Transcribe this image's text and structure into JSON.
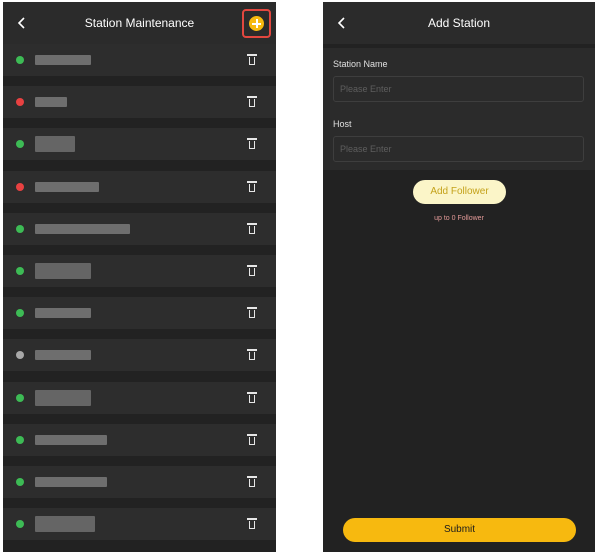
{
  "left_screen": {
    "title": "Station Maintenance",
    "stations": [
      {
        "status_color": "#3dbb55"
      },
      {
        "status_color": "#e84141"
      },
      {
        "status_color": "#3dbb55"
      },
      {
        "status_color": "#e84141"
      },
      {
        "status_color": "#3dbb55"
      },
      {
        "status_color": "#3dbb55"
      },
      {
        "status_color": "#3dbb55"
      },
      {
        "status_color": "#a8a8a8"
      },
      {
        "status_color": "#3dbb55"
      },
      {
        "status_color": "#3dbb55"
      },
      {
        "status_color": "#3dbb55"
      },
      {
        "status_color": "#3dbb55"
      }
    ]
  },
  "right_screen": {
    "title": "Add Station",
    "station_name": {
      "label": "Station Name",
      "placeholder": "Please Enter",
      "value": ""
    },
    "host": {
      "label": "Host",
      "placeholder": "Please Enter",
      "value": ""
    },
    "add_follower_label": "Add Follower",
    "follower_note": "up to 0 Follower",
    "submit_label": "Submit"
  },
  "colors": {
    "accent": "#f7b90f",
    "highlight_border": "#e2473f",
    "background": "#222222"
  }
}
